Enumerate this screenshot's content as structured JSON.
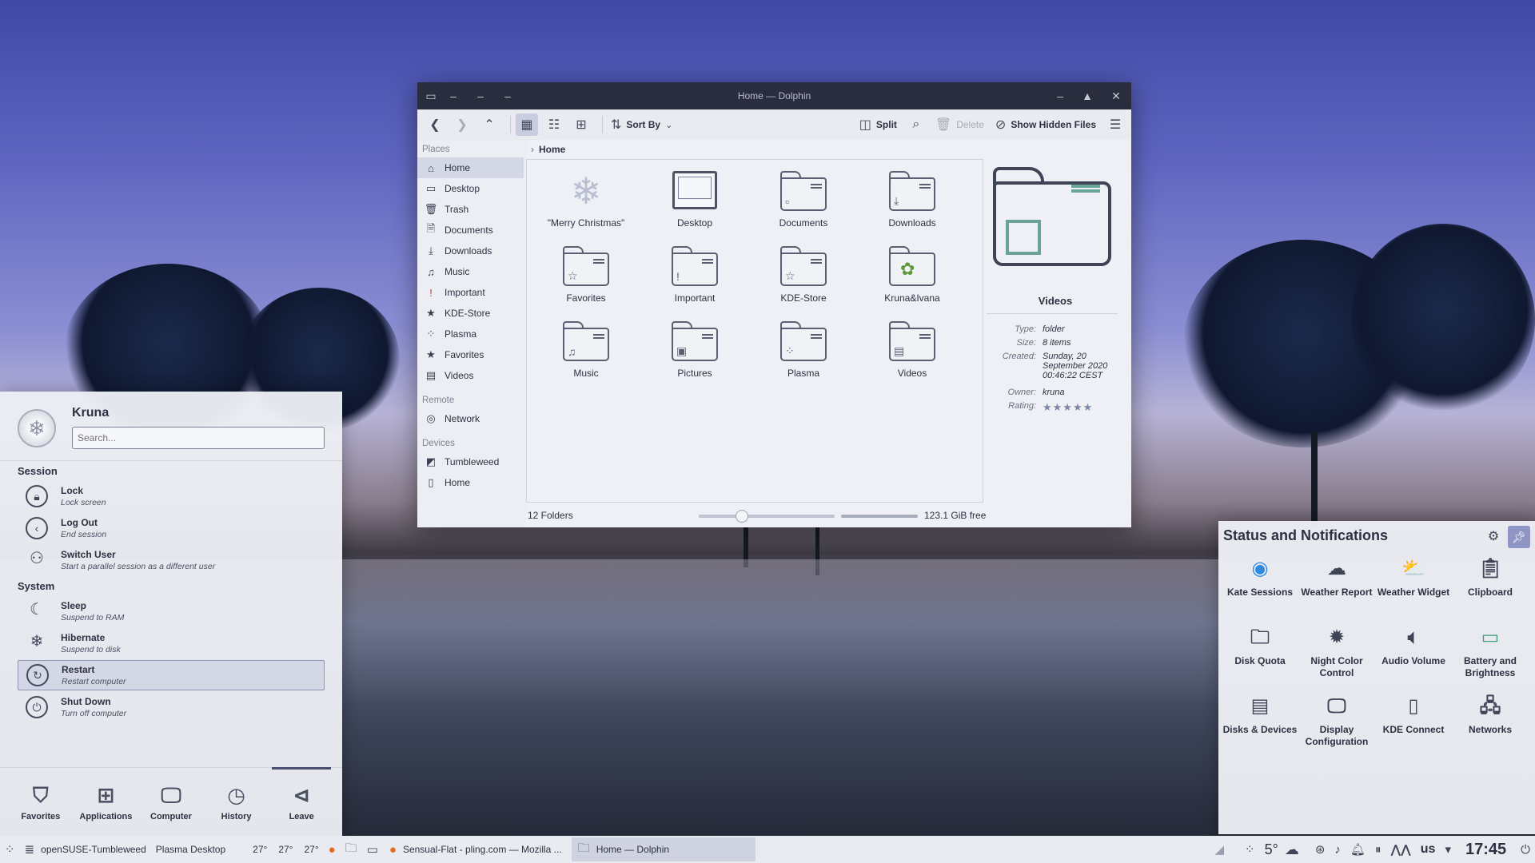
{
  "dolphin": {
    "title": "Home — Dolphin",
    "toolbar": {
      "sort_by": "Sort By",
      "split": "Split",
      "delete": "Delete",
      "show_hidden": "Show Hidden Files"
    },
    "places": {
      "places_header": "Places",
      "remote_header": "Remote",
      "devices_header": "Devices",
      "items": [
        "Home",
        "Desktop",
        "Trash",
        "Documents",
        "Downloads",
        "Music",
        "Important",
        "KDE-Store",
        "Plasma",
        "Favorites",
        "Videos"
      ],
      "remote": [
        "Network"
      ],
      "devices": [
        "Tumbleweed",
        "Home"
      ]
    },
    "breadcrumb": "Home",
    "folders": [
      "\"Merry Christmas\"",
      "Desktop",
      "Documents",
      "Downloads",
      "Favorites",
      "Important",
      "KDE-Store",
      "Kruna&Ivana",
      "Music",
      "Pictures",
      "Plasma",
      "Videos"
    ],
    "info": {
      "name": "Videos",
      "type_label": "Type:",
      "type": "folder",
      "size_label": "Size:",
      "size": "8 items",
      "created_label": "Created:",
      "created": "Sunday, 20 September 2020 00:46:22 CEST",
      "owner_label": "Owner:",
      "owner": "kruna",
      "rating_label": "Rating:",
      "rating": "★★★★★"
    },
    "status": {
      "count": "12 Folders",
      "free": "123.1 GiB free",
      "zoom_fraction": 0.3
    }
  },
  "launcher": {
    "user": "Kruna",
    "search_placeholder": "Search...",
    "session_header": "Session",
    "system_header": "System",
    "session": [
      {
        "title": "Lock",
        "subtitle": "Lock screen"
      },
      {
        "title": "Log Out",
        "subtitle": "End session"
      },
      {
        "title": "Switch User",
        "subtitle": "Start a parallel session as a different user"
      }
    ],
    "system": [
      {
        "title": "Sleep",
        "subtitle": "Suspend to RAM"
      },
      {
        "title": "Hibernate",
        "subtitle": "Suspend to disk"
      },
      {
        "title": "Restart",
        "subtitle": "Restart computer"
      },
      {
        "title": "Shut Down",
        "subtitle": "Turn off computer"
      }
    ],
    "tabs": [
      "Favorites",
      "Applications",
      "Computer",
      "History",
      "Leave"
    ]
  },
  "tray": {
    "title": "Status and Notifications",
    "items": [
      "Kate Sessions",
      "Weather Report",
      "Weather Widget",
      "Clipboard",
      "Disk Quota",
      "Night Color Control",
      "Audio Volume",
      "Battery and Brightness",
      "Disks & Devices",
      "Display Configuration",
      "KDE Connect",
      "Networks"
    ]
  },
  "panel": {
    "distro": "openSUSE-Tumbleweed",
    "desktop": "Plasma Desktop",
    "temps": [
      "27°",
      "27°",
      "27°"
    ],
    "task_firefox": "Sensual-Flat - pling.com — Mozilla ...",
    "task_dolphin": "Home — Dolphin",
    "weather_temp": "5°",
    "keyboard": "us",
    "clock": "17:45"
  }
}
